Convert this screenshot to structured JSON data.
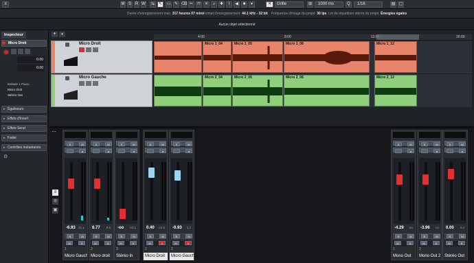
{
  "toolbar": {
    "modes": [
      "M",
      "S",
      "R",
      "W"
    ],
    "grid_label": "Grille",
    "zoom_label": "1000 ms",
    "quantize": "1/16"
  },
  "infobar": {
    "rec_time_label": "Durée d'enregistrement max.",
    "rec_time_value": "317 heures 07 mins",
    "format_label": "Format d'enregistrement",
    "format_value": "44.1 kHz - 32 bit",
    "fps_label": "Fréquence d'image du projet",
    "fps_value": "30 ips",
    "pan_label": "Loi de répartition stéréo du projet",
    "pan_value": "Énergies égales"
  },
  "status": {
    "selection": "Aucun objet sélectionné"
  },
  "inspector": {
    "tab": "Inspecteur",
    "track_name": "Micro Droit",
    "values": [
      "0.00",
      "0.00"
    ],
    "routing": [
      "Ballade 1 Piano",
      "Micro droit",
      "Stéréo Out"
    ],
    "sections": [
      "Égaliseurs",
      "Effets d'Insert",
      "Effets Send",
      "Fader",
      "Contrôles instantanés"
    ]
  },
  "ruler": [
    "4:00",
    "8:00",
    "12:00",
    "16:00"
  ],
  "tracks": [
    {
      "name": "Micro Droit",
      "color": "#e8846a",
      "clips": [
        "Micro 1_04",
        "Micro 1_05",
        "Micro 1_06",
        "Micro 1_12"
      ]
    },
    {
      "name": "Micro Gauche",
      "color": "#8fcf7c",
      "clips": [
        "Micro 2_04",
        "Micro 2_05",
        "Micro 2_06",
        "Micro 2_12"
      ]
    }
  ],
  "mixer": {
    "channels": [
      {
        "name": "Micro Gauche",
        "value": "-6.93",
        "peak": "-31.1",
        "num": "1",
        "selected": false,
        "meter": 0.08
      },
      {
        "name": "Micro droit",
        "value": "6.77",
        "peak": "8.6",
        "num": "2",
        "selected": false,
        "meter": 0.05
      },
      {
        "name": "Stéréo In",
        "value": "-oo",
        "peak": "-23.1",
        "num": "3",
        "selected": false,
        "meter": 0.0
      },
      {
        "name": "Micro Droit",
        "value": "0.40",
        "peak": "-10.5",
        "num": "1",
        "selected": true,
        "meter": 0.0
      },
      {
        "name": "Micro Gauche",
        "value": "-0.93",
        "peak": "2.2",
        "num": "2",
        "selected": true,
        "meter": 0.0
      },
      {
        "name": "Mono Out",
        "value": "-4.29",
        "peak": "-oo",
        "num": "1",
        "selected": false,
        "meter": 0.0
      },
      {
        "name": "Mono Out 2",
        "value": "-3.96",
        "peak": "-oo",
        "num": "2",
        "selected": false,
        "meter": 0.0
      },
      {
        "name": "Stéréo Out",
        "value": "0.00",
        "peak": "0.2",
        "num": "",
        "selected": false,
        "meter": 0.0
      }
    ],
    "pan_labels": [
      "C",
      "L4"
    ],
    "button_labels": [
      "S",
      "W",
      "R",
      "M"
    ]
  }
}
